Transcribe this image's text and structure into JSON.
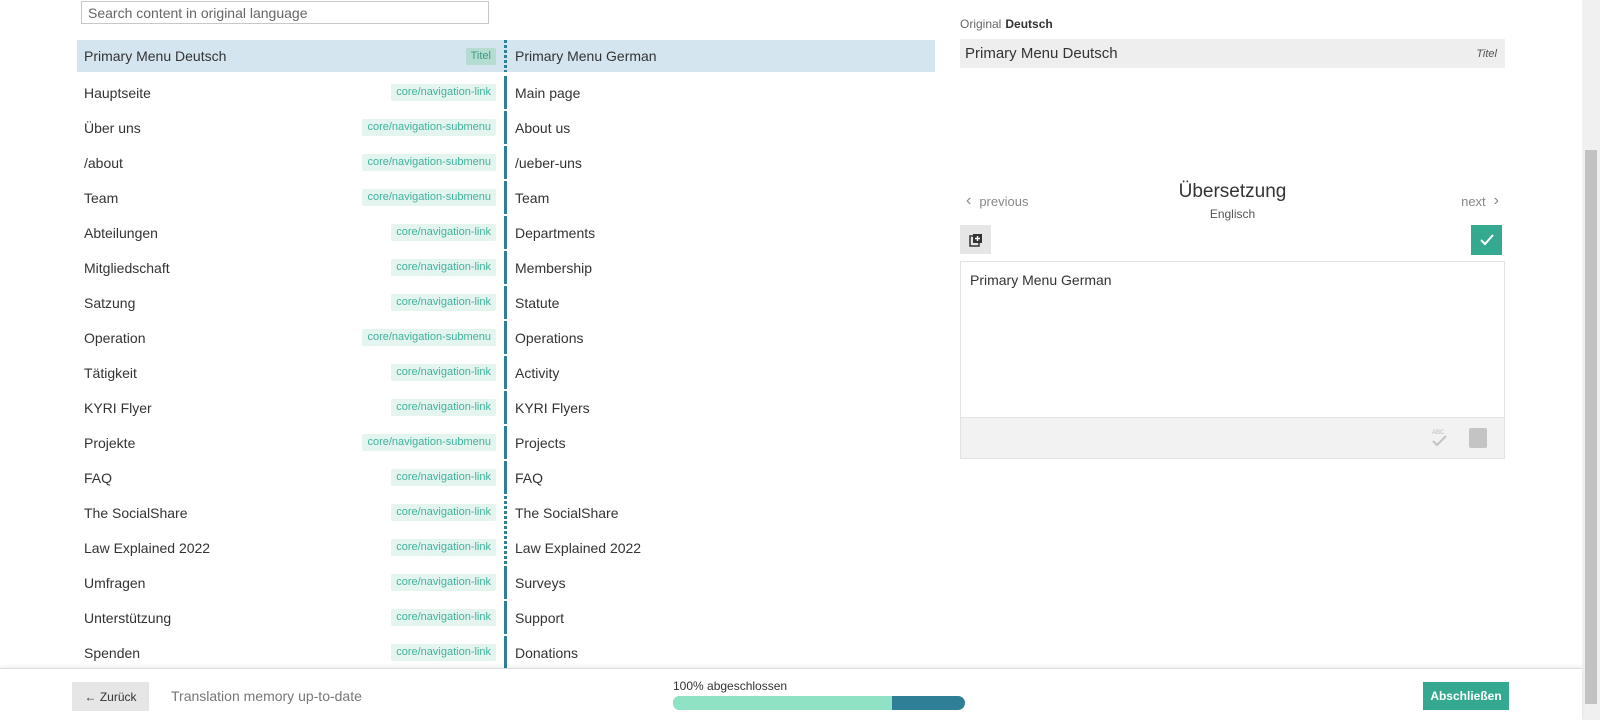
{
  "search": {
    "placeholder": "Search content in original language"
  },
  "rows": [
    {
      "source": "Primary Menu Deutsch",
      "tag": "Titel",
      "target": "Primary Menu German",
      "selected": true
    },
    {
      "source": "Hauptseite",
      "tag": "core/navigation-link",
      "target": "Main page"
    },
    {
      "source": "Über uns",
      "tag": "core/navigation-submenu",
      "target": "About us"
    },
    {
      "source": "/about",
      "tag": "core/navigation-submenu",
      "target": "/ueber-uns"
    },
    {
      "source": "Team",
      "tag": "core/navigation-submenu",
      "target": "Team"
    },
    {
      "source": "Abteilungen",
      "tag": "core/navigation-link",
      "target": "Departments"
    },
    {
      "source": "Mitgliedschaft",
      "tag": "core/navigation-link",
      "target": "Membership"
    },
    {
      "source": "Satzung",
      "tag": "core/navigation-link",
      "target": "Statute"
    },
    {
      "source": "Operation",
      "tag": "core/navigation-submenu",
      "target": "Operations"
    },
    {
      "source": "Tätigkeit",
      "tag": "core/navigation-link",
      "target": "Activity"
    },
    {
      "source": "KYRI Flyer",
      "tag": "core/navigation-link",
      "target": "KYRI Flyers"
    },
    {
      "source": "Projekte",
      "tag": "core/navigation-submenu",
      "target": "Projects"
    },
    {
      "source": "FAQ",
      "tag": "core/navigation-link",
      "target": "FAQ"
    },
    {
      "source": "The SocialShare",
      "tag": "core/navigation-link",
      "target": "The SocialShare"
    },
    {
      "source": "Law Explained 2022",
      "tag": "core/navigation-link",
      "target": "Law Explained 2022"
    },
    {
      "source": "Umfragen",
      "tag": "core/navigation-link",
      "target": "Surveys"
    },
    {
      "source": "Unterstützung",
      "tag": "core/navigation-link",
      "target": "Support"
    },
    {
      "source": "Spenden",
      "tag": "core/navigation-link",
      "target": "Donations"
    }
  ],
  "original": {
    "label": "Original",
    "language": "Deutsch",
    "text": "Primary Menu Deutsch",
    "tag": "Titel"
  },
  "translation": {
    "title": "Übersetzung",
    "language": "Englisch",
    "previous_label": "previous",
    "next_label": "next",
    "text": "Primary Menu German"
  },
  "footer": {
    "back_label": "← Zurück",
    "tm_status": "Translation memory up-to-date",
    "progress_label": "100% abgeschlossen",
    "progress_fraction": 0.75,
    "finish_label": "Abschließen"
  },
  "colors": {
    "accent": "#35a98f",
    "separator": "#2f7f96",
    "selected_row": "#d5e5ef",
    "tag_text": "#3fb39d"
  },
  "icons": {
    "copy": "copy-original-icon",
    "confirm": "checkmark-icon",
    "spellcheck": "spellcheck-icon",
    "dictionary": "dictionary-icon"
  }
}
